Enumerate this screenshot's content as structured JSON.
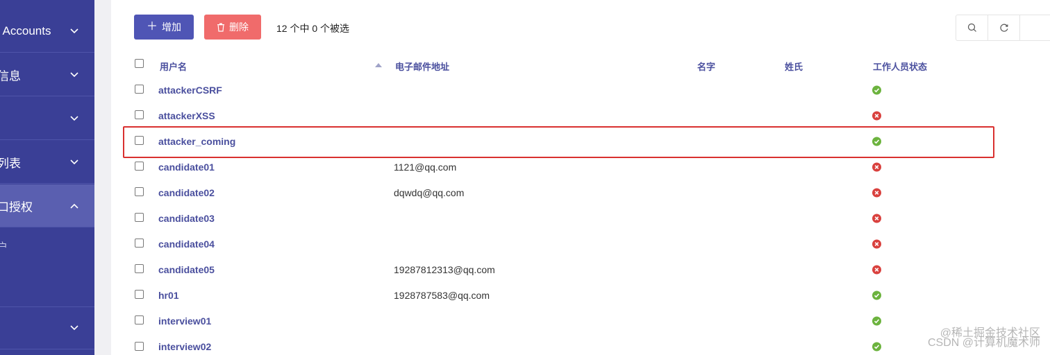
{
  "sidebar": {
    "items": [
      {
        "label": "l Accounts",
        "expanded": false
      },
      {
        "label": "信息",
        "expanded": false
      },
      {
        "label": "",
        "expanded": false
      },
      {
        "label": "列表",
        "expanded": false
      },
      {
        "label": "口授权",
        "expanded": true
      },
      {
        "label": "",
        "expanded": false
      }
    ],
    "sub_item": "户",
    "colors": {
      "bg": "#3a3f96",
      "active": "#5a5fb0"
    }
  },
  "toolbar": {
    "add_label": "增加",
    "delete_label": "删除",
    "selection_text": "12 个中 0 个被选",
    "tools": [
      "search-icon",
      "refresh-icon",
      ""
    ]
  },
  "table": {
    "columns": [
      "用户名",
      "电子邮件地址",
      "名字",
      "姓氏",
      "工作人员状态"
    ],
    "rows": [
      {
        "username": "attackerCSRF",
        "email": "",
        "staff": true
      },
      {
        "username": "attackerXSS",
        "email": "",
        "staff": false
      },
      {
        "username": "attacker_coming",
        "email": "",
        "staff": true
      },
      {
        "username": "candidate01",
        "email": "1121@qq.com",
        "staff": false
      },
      {
        "username": "candidate02",
        "email": "dqwdq@qq.com",
        "staff": false
      },
      {
        "username": "candidate03",
        "email": "",
        "staff": false
      },
      {
        "username": "candidate04",
        "email": "",
        "staff": false
      },
      {
        "username": "candidate05",
        "email": "19287812313@qq.com",
        "staff": false
      },
      {
        "username": "hr01",
        "email": "1928787583@qq.com",
        "staff": true
      },
      {
        "username": "interview01",
        "email": "",
        "staff": true
      },
      {
        "username": "interview02",
        "email": "",
        "staff": true
      }
    ]
  },
  "watermark": {
    "line1": "@稀土掘金技术社区",
    "line2": "CSDN @计算机魔术师"
  }
}
